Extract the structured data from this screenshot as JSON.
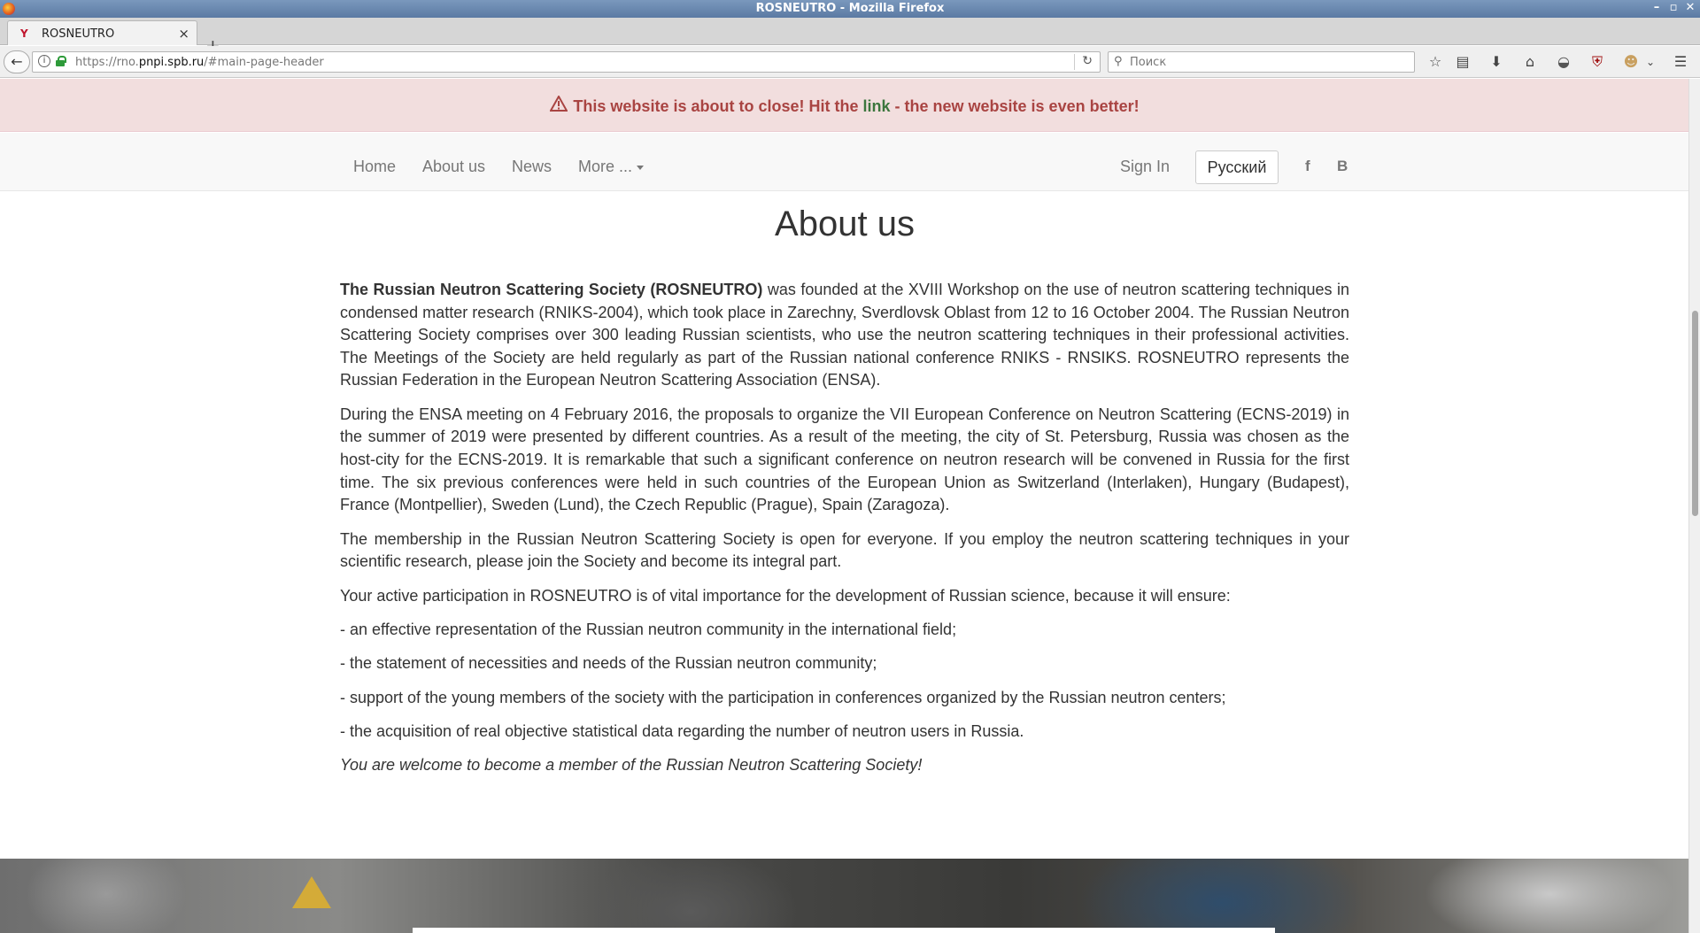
{
  "window": {
    "title": "ROSNEUTRO - Mozilla Firefox"
  },
  "browser": {
    "tab_label": "ROSNEUTRO",
    "url_prefix": "https://rno.",
    "url_domain": "pnpi.spb.ru",
    "url_suffix": "/#main-page-header",
    "search_placeholder": "Поиск"
  },
  "alert": {
    "text_before": "This website is about to close! Hit the",
    "link_text": "link",
    "text_after": "- the new website is even better!",
    "text_color": "#a94442",
    "link_color": "#3c763d",
    "background": "#f2dede"
  },
  "nav": {
    "home": "Home",
    "about": "About us",
    "news": "News",
    "more": "More ...",
    "sign_in": "Sign In",
    "language": "Русский",
    "facebook": "f",
    "vk": "B"
  },
  "page": {
    "heading": "About us",
    "intro_bold": "The Russian Neutron Scattering Society (ROSNEUTRO)",
    "intro_rest": " was founded at the XVIII Workshop on the use of neutron scattering techniques in condensed matter research (RNIKS-2004), which took place in Zarechny, Sverdlovsk Oblast from 12 to 16 October 2004. The Russian Neutron Scattering Society comprises over 300 leading Russian scientists, who use the neutron scattering techniques in their professional activities. The Meetings of the Society are held regularly as part of the Russian national conference RNIKS - RNSIKS. ROSNEUTRO represents the Russian Federation in the European Neutron Scattering Association (ENSA).",
    "paragraph2": "During the ENSA meeting on 4 February 2016, the proposals to organize the VII European Conference on Neutron Scattering (ECNS-2019) in the summer of 2019 were presented by different countries. As a result of the meeting, the city of St. Petersburg, Russia was chosen as the host-city for the ECNS-2019. It is remarkable that such a significant conference on neutron research will be convened in Russia for the first time. The six previous conferences were held in such countries of the European Union as Switzerland (Interlaken), Hungary (Budapest), France (Montpellier), Sweden (Lund), the Czech Republic (Prague), Spain (Zaragoza).",
    "paragraph3": "The membership in the Russian Neutron Scattering Society is open for everyone. If you employ the neutron scattering techniques in your scientific research, please join the Society and become its integral part.",
    "paragraph4": "Your active participation in ROSNEUTRO is of vital importance for the development of Russian science, because it will ensure:",
    "bullet1": "- an effective representation of the Russian neutron community in the international field;",
    "bullet2": "- the statement of necessities and needs of the Russian neutron community;",
    "bullet3": "- support of the young members of the society with the participation in conferences organized by the Russian neutron centers;",
    "bullet4": "- the acquisition of real objective statistical data regarding the number of neutron users in Russia.",
    "closing": "You are welcome to become a member of the Russian Neutron Scattering Society!"
  },
  "icons": {
    "back": "back-arrow-icon",
    "info": "info-icon",
    "lock": "lock-icon",
    "reload": "reload-icon",
    "search": "search-icon",
    "bookmark": "star-icon",
    "reader": "reading-list-icon",
    "download": "download-icon",
    "home": "home-icon",
    "pocket": "pocket-icon",
    "ublock": "ublock-shield-icon",
    "menu": "hamburger-menu-icon",
    "warning": "warning-triangle-icon"
  }
}
